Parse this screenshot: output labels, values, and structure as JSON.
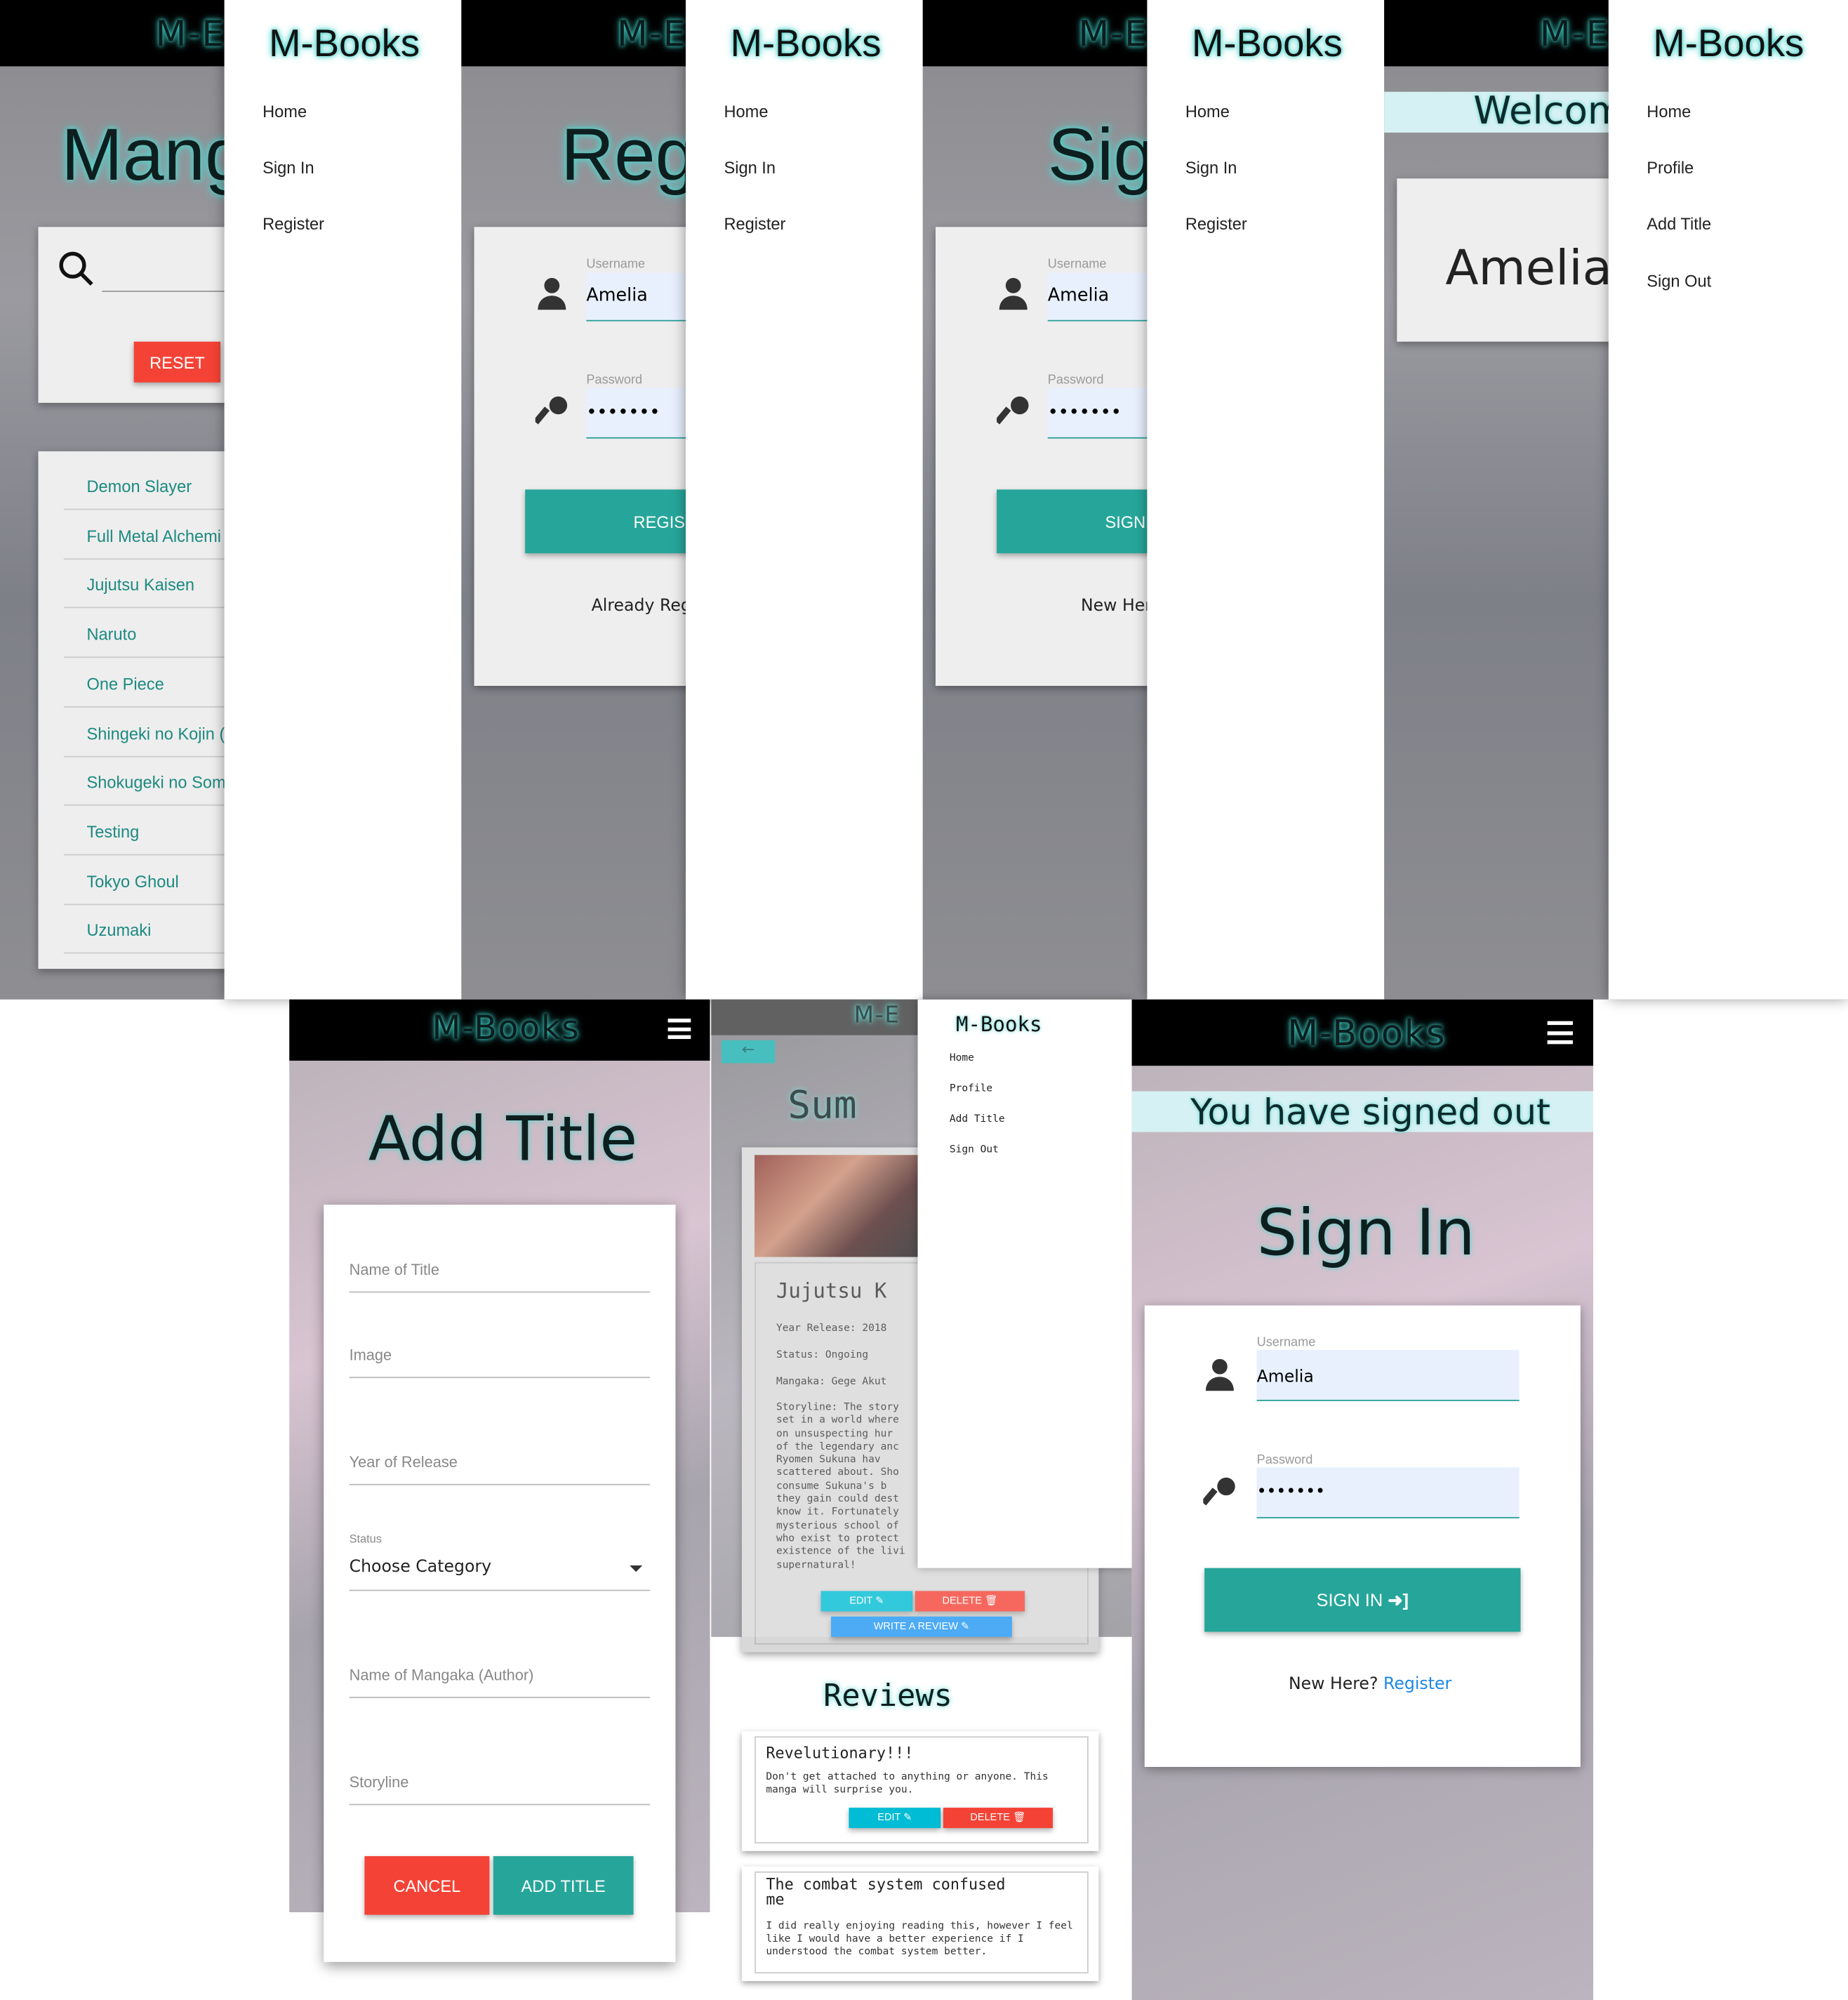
{
  "brand": "M-Books",
  "brand_partial": "M-E",
  "panel1": {
    "title": "Mang",
    "reset": "RESET",
    "items": [
      "Demon Slayer",
      "Full Metal Alchemi",
      "Jujutsu Kaisen",
      "Naruto",
      "One Piece",
      "Shingeki no Kojin (",
      "Shokugeki no Som",
      "Testing",
      "Tokyo Ghoul",
      "Uzumaki"
    ]
  },
  "drawer_guest": {
    "items": [
      "Home",
      "Sign In",
      "Register"
    ]
  },
  "drawer_user": {
    "items": [
      "Home",
      "Profile",
      "Add Title",
      "Sign Out"
    ]
  },
  "panel2": {
    "title": "Reg",
    "username_label": "Username",
    "username": "Amelia",
    "password_label": "Password",
    "password": "•••••••",
    "button": "REGIS",
    "footer": "Already Regi"
  },
  "panel3": {
    "title": "Sig",
    "username_label": "Username",
    "username": "Amelia",
    "password_label": "Password",
    "password": "•••••••",
    "button": "SIGN",
    "footer": "New Here"
  },
  "panel4": {
    "welcome": "Welcom",
    "name": "Amelia'"
  },
  "add_title": {
    "title": "Add Title",
    "fields": [
      "Name of Title",
      "Image",
      "Year of Release"
    ],
    "status_label": "Status",
    "status_value": "Choose Category",
    "fields2": [
      "Name of Mangaka (Author)",
      "Storyline"
    ],
    "cancel": "CANCEL",
    "add": "ADD TITLE"
  },
  "summary": {
    "title": "Sum",
    "manga": "Jujutsu K",
    "year": "Year Release: 2018",
    "status": "Status: Ongoing",
    "mangaka": "Mangaka: Gege Akut",
    "storyline": [
      "Storyline: The story",
      "set in a world where",
      "on unsuspecting hur",
      "of the legendary anc",
      "Ryomen Sukuna hav",
      "scattered about. Sho",
      "consume Sukuna's b",
      "they gain could dest",
      "know it. Fortunately",
      "mysterious school of",
      "who exist to protect",
      "existence of the livi",
      "supernatural!"
    ],
    "edit": "EDIT",
    "delete": "DELETE",
    "write": "WRITE A REVIEW",
    "reviews_title": "Reviews",
    "reviews": [
      {
        "title": "Revelutionary!!!",
        "body": "Don't get attached to anything or anyone. This manga will surprise you."
      },
      {
        "title": "The combat system confused me",
        "body": "I did really enjoying reading this, however I feel like I would have a better experience if I understood the combat system better."
      }
    ]
  },
  "signout": {
    "notice": "You have signed out",
    "title": "Sign In",
    "username_label": "Username",
    "username": "Amelia",
    "password_label": "Password",
    "password": "•••••••",
    "button": "SIGN IN",
    "footer": "New Here?",
    "register": "Register"
  }
}
